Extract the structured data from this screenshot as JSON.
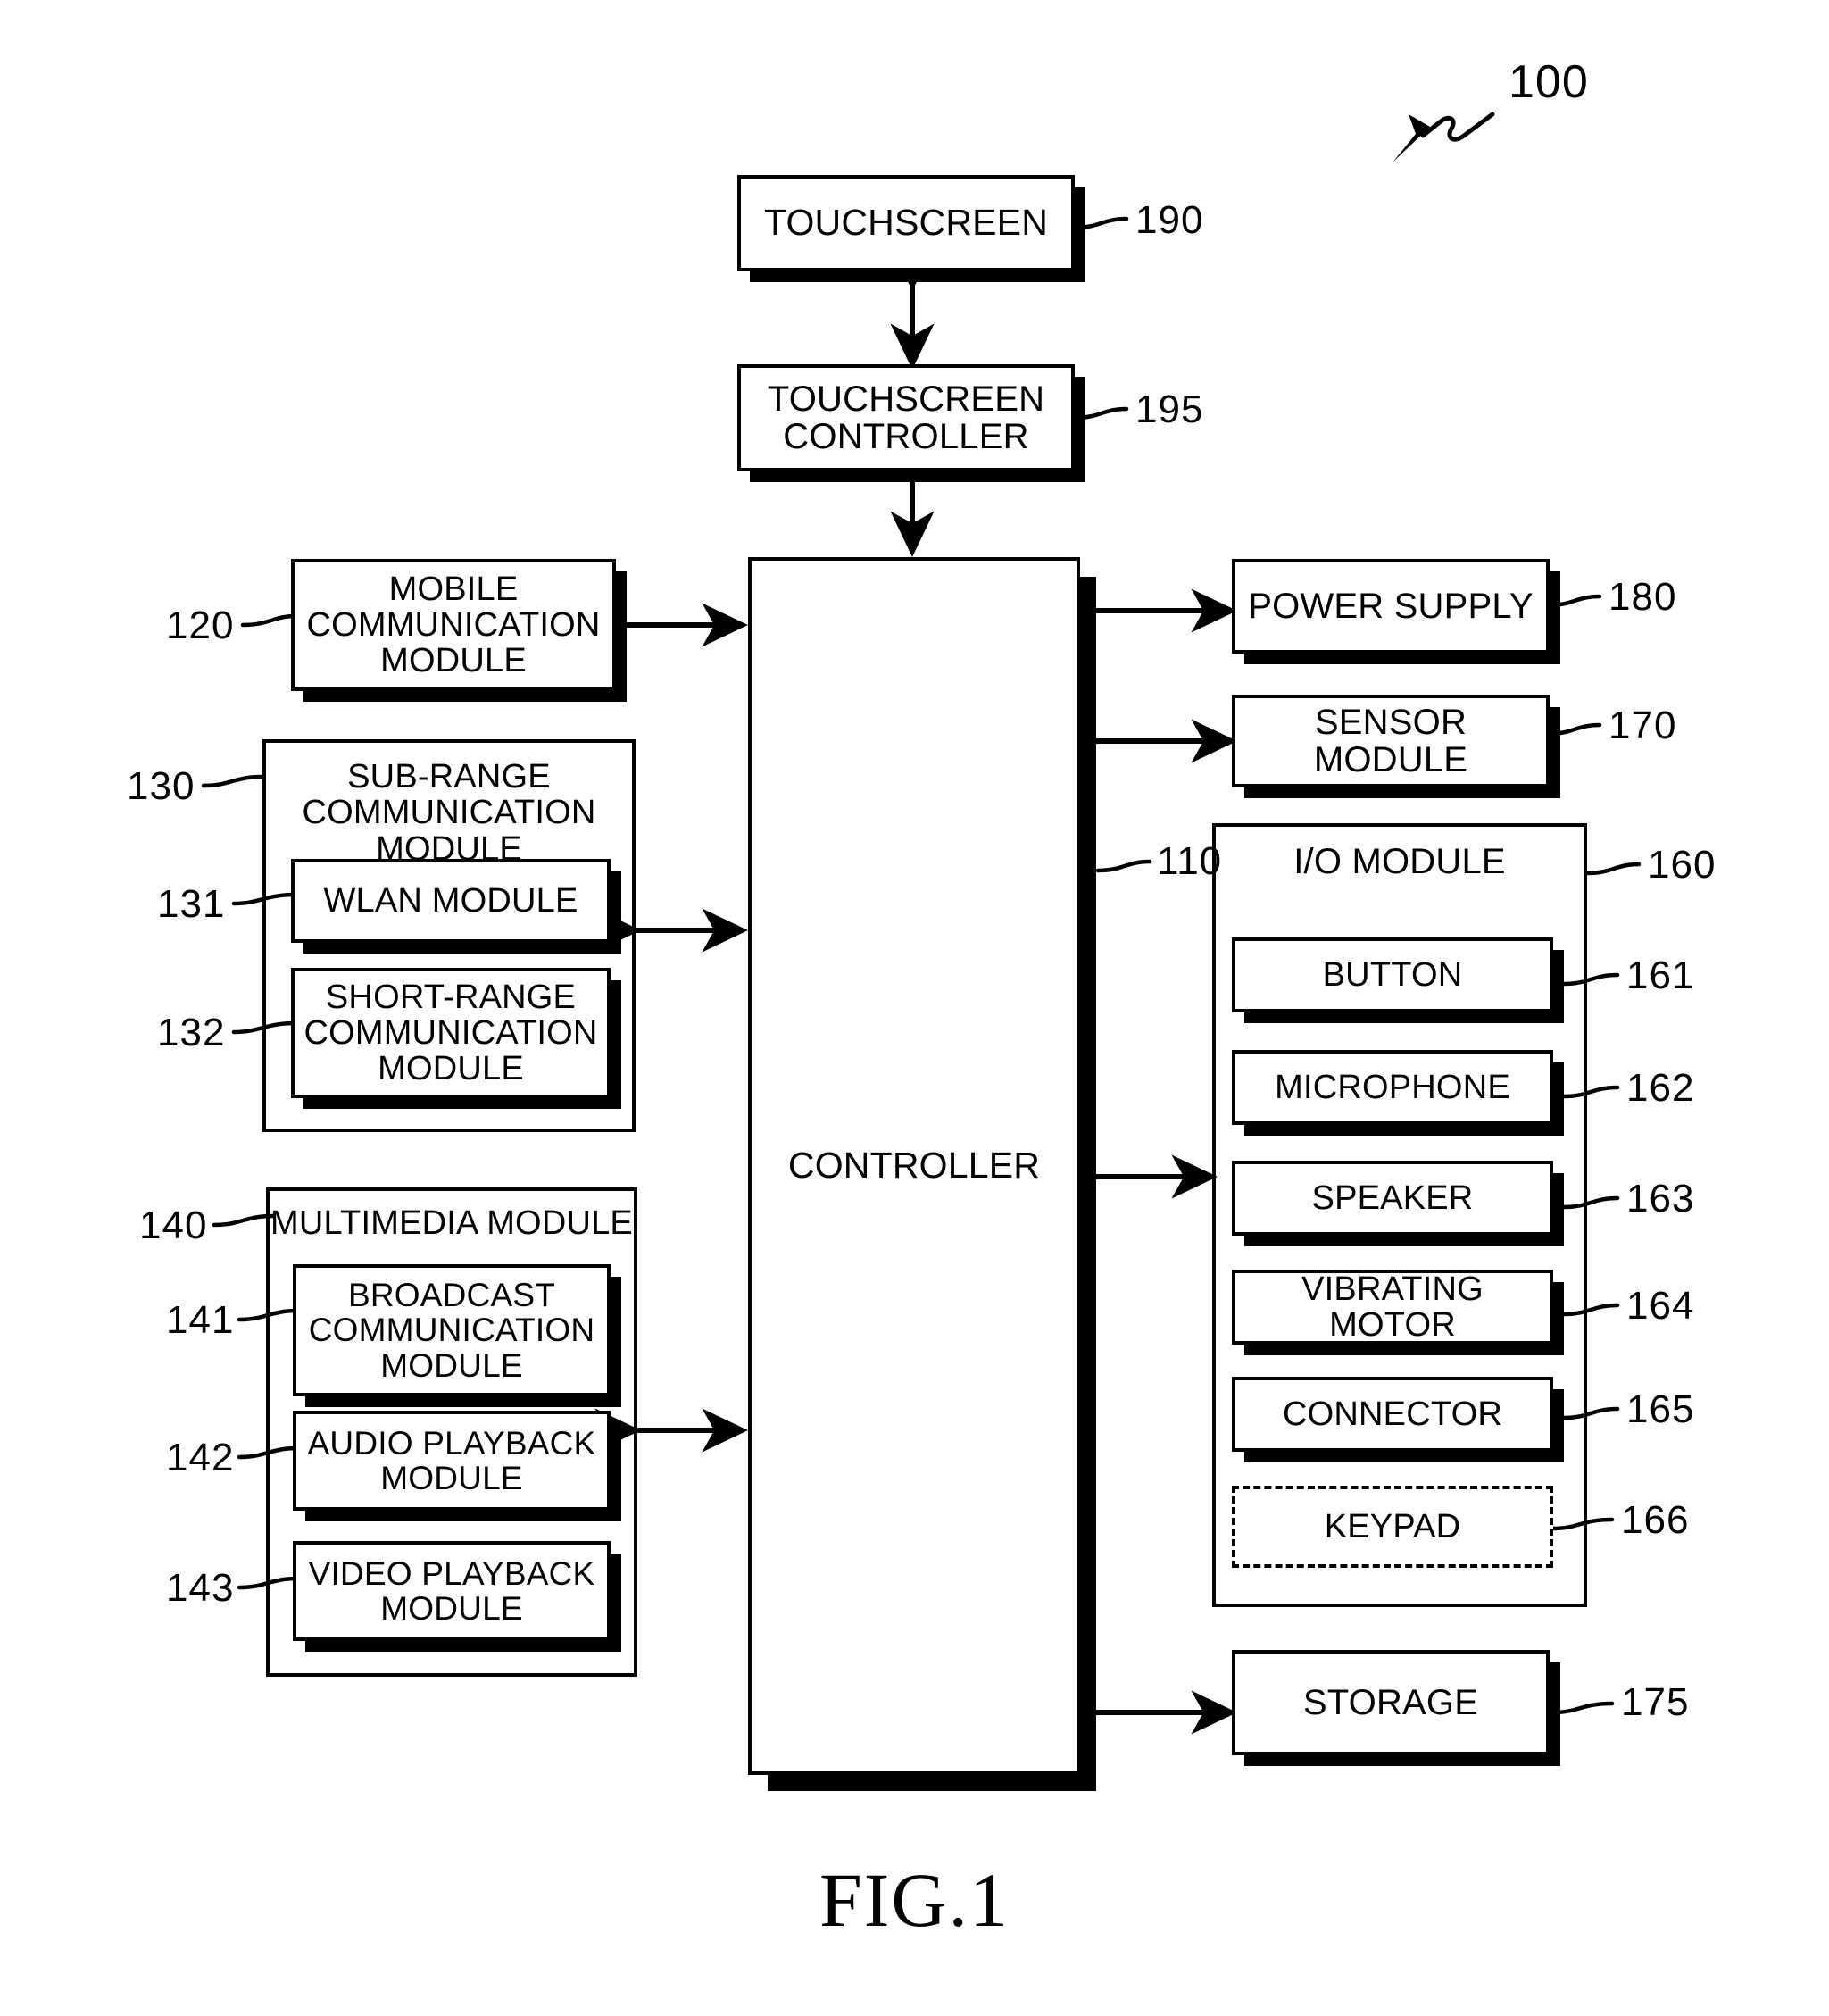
{
  "figure": {
    "caption": "FIG.1",
    "system_ref": "100"
  },
  "nodes": {
    "touchscreen": {
      "label": "TOUCHSCREEN",
      "ref": "190"
    },
    "touchscreen_controller": {
      "label": "TOUCHSCREEN\nCONTROLLER",
      "ref": "195"
    },
    "controller": {
      "label": "CONTROLLER",
      "ref": "110"
    },
    "mobile_comm": {
      "label": "MOBILE\nCOMMUNICATION\nMODULE",
      "ref": "120"
    },
    "sub_range": {
      "label": "SUB-RANGE\nCOMMUNICATION\nMODULE",
      "ref": "130"
    },
    "wlan": {
      "label": "WLAN MODULE",
      "ref": "131"
    },
    "short_range": {
      "label": "SHORT-RANGE\nCOMMUNICATION\nMODULE",
      "ref": "132"
    },
    "multimedia": {
      "label": "MULTIMEDIA MODULE",
      "ref": "140"
    },
    "broadcast": {
      "label": "BROADCAST\nCOMMUNICATION\nMODULE",
      "ref": "141"
    },
    "audio_playback": {
      "label": "AUDIO PLAYBACK\nMODULE",
      "ref": "142"
    },
    "video_playback": {
      "label": "VIDEO PLAYBACK\nMODULE",
      "ref": "143"
    },
    "power_supply": {
      "label": "POWER SUPPLY",
      "ref": "180"
    },
    "sensor_module": {
      "label": "SENSOR MODULE",
      "ref": "170"
    },
    "io_module": {
      "label": "I/O MODULE",
      "ref": "160"
    },
    "button": {
      "label": "BUTTON",
      "ref": "161"
    },
    "microphone": {
      "label": "MICROPHONE",
      "ref": "162"
    },
    "speaker": {
      "label": "SPEAKER",
      "ref": "163"
    },
    "vibrating_motor": {
      "label": "VIBRATING MOTOR",
      "ref": "164"
    },
    "connector": {
      "label": "CONNECTOR",
      "ref": "165"
    },
    "keypad": {
      "label": "KEYPAD",
      "ref": "166"
    },
    "storage": {
      "label": "STORAGE",
      "ref": "175"
    }
  },
  "colors": {
    "ink": "#000000",
    "paper": "#ffffff"
  }
}
